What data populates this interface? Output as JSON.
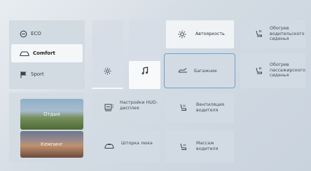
{
  "drive_modes": [
    {
      "label": "ECO",
      "icon": "eco-icon"
    },
    {
      "label": "Comfort",
      "icon": "car-icon",
      "active": true
    },
    {
      "label": "Sport",
      "icon": "flag-icon"
    }
  ],
  "scenes": [
    {
      "label": "Отдых"
    },
    {
      "label": "Кемпинг"
    }
  ],
  "sliders": {
    "brightness": {
      "icon": "sun-icon",
      "level": 0.02
    },
    "volume": {
      "icon": "music-note-icon",
      "level": 0.4
    }
  },
  "tiles": {
    "auto_brightness": "Автояркость",
    "trunk": "Багажник",
    "driver_seat_heating": "Обогрев водительского сиденья",
    "passenger_seat_heating": "Обогрев пассажирского сиденья",
    "hud_settings": "Настройки HUD-дисплея",
    "driver_ventilation": "Вентиляция водителя",
    "hatch_curtain": "Шторка люка",
    "driver_massage": "Массаж водителя"
  },
  "colors": {
    "focus_border": "#6f9fd0",
    "active_tile": "#f1f4f7",
    "background": "#d3dbe3"
  }
}
